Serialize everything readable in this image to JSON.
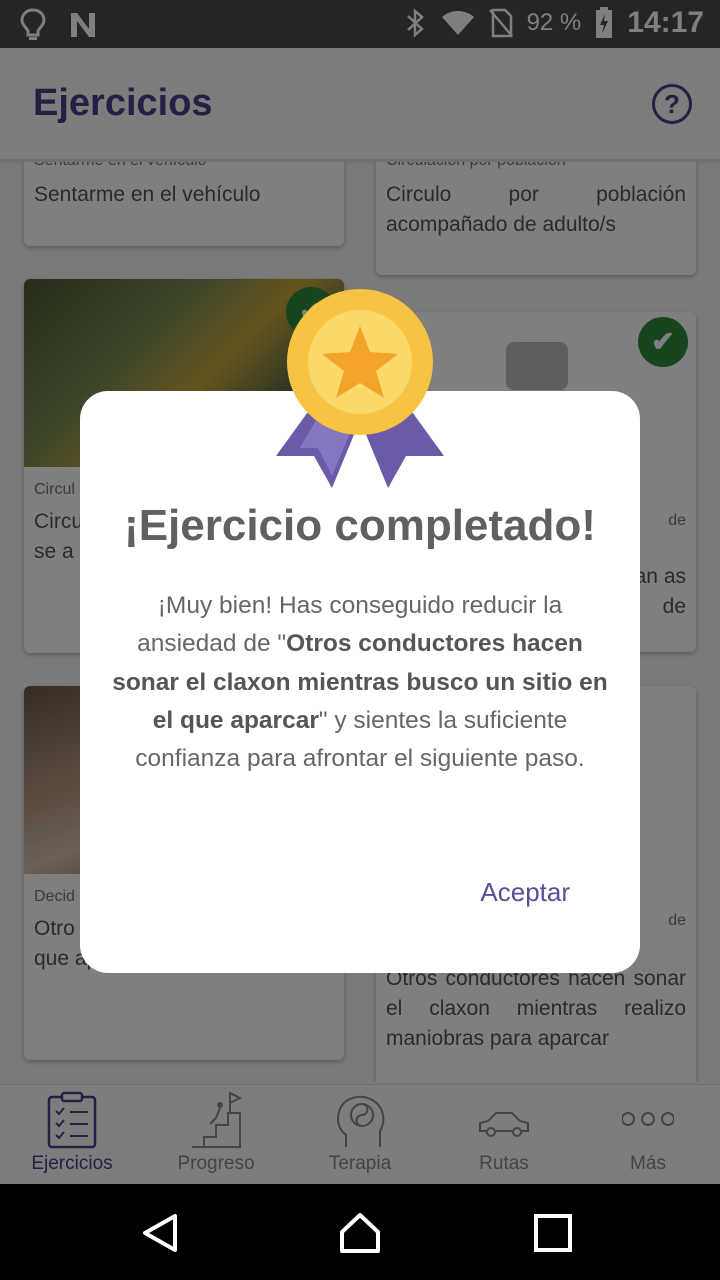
{
  "status_bar": {
    "battery_percent": "92 %",
    "time": "14:17",
    "icons": [
      "lightbulb-icon",
      "n-app-icon",
      "bluetooth-icon",
      "wifi-icon",
      "no-sim-icon",
      "battery-charging-icon"
    ]
  },
  "app_bar": {
    "title": "Ejercicios",
    "help_icon": "?"
  },
  "cards": [
    {
      "category": "Sentarme en el vehículo",
      "text": "Sentarme en el vehículo",
      "completed": true
    },
    {
      "category": "Circulación por población",
      "text": "Circulo por población acompañado de adulto/s",
      "completed": true
    },
    {
      "category": "Circul",
      "text": "Circu circu se a coch",
      "completed": true
    },
    {
      "category": "",
      "text": "de",
      "text2": "miran as de",
      "completed": true
    },
    {
      "category": "Decid",
      "text": "Otro sona busco un sitio en el que aparcar",
      "completed": false
    },
    {
      "category": "",
      "text": "de",
      "text2": "Otros conductores hacen sonar el claxon mientras realizo maniobras para aparcar",
      "completed": false
    }
  ],
  "check_mark": "✔",
  "dialog": {
    "title": "¡Ejercicio completado!",
    "message_prefix": "¡Muy bien! Has conseguido reducir la ansiedad de \"",
    "message_bold": "Otros conductores hacen sonar el claxon mientras busco un sitio en el que aparcar",
    "message_suffix": "\" y sientes la suficiente confianza para afrontar el siguiente paso.",
    "accept_label": "Aceptar"
  },
  "bottom_nav": [
    {
      "label": "Ejercicios",
      "icon": "clipboard-checklist-icon",
      "active": true
    },
    {
      "label": "Progreso",
      "icon": "stairs-flag-icon",
      "active": false
    },
    {
      "label": "Terapia",
      "icon": "head-yin-yang-icon",
      "active": false
    },
    {
      "label": "Rutas",
      "icon": "car-icon",
      "active": false
    },
    {
      "label": "Más",
      "icon": "more-dots-icon",
      "active": false
    }
  ],
  "colors": {
    "accent": "#4b3f86",
    "check_green": "#2e8b3d",
    "medal_gold": "#f6c342",
    "ribbon_purple": "#6a5aa8"
  }
}
